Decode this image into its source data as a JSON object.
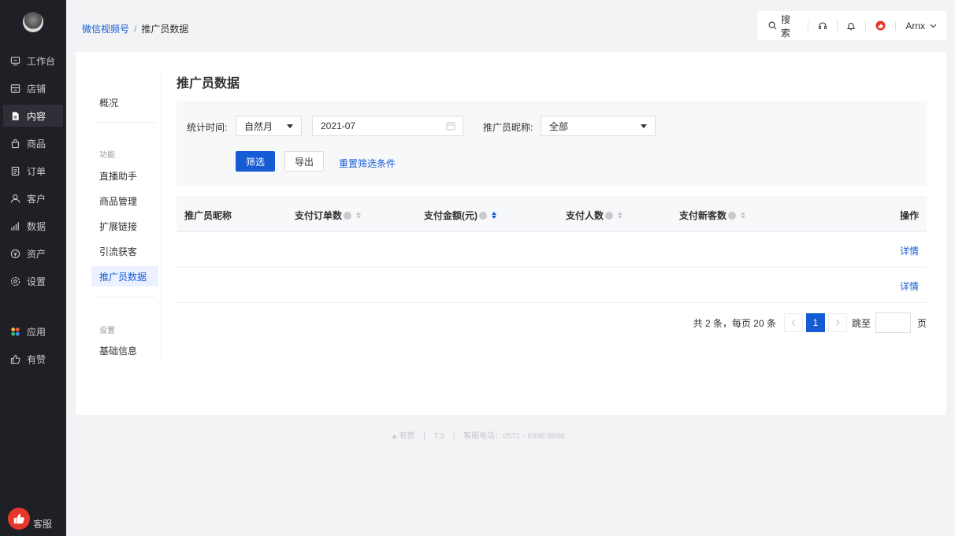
{
  "sidebar": {
    "items": [
      {
        "label": "工作台",
        "icon": "workbench-icon"
      },
      {
        "label": "店铺",
        "icon": "store-icon"
      },
      {
        "label": "内容",
        "icon": "content-icon",
        "active": true
      },
      {
        "label": "商品",
        "icon": "goods-icon"
      },
      {
        "label": "订单",
        "icon": "order-icon"
      },
      {
        "label": "客户",
        "icon": "customer-icon"
      },
      {
        "label": "数据",
        "icon": "data-icon"
      },
      {
        "label": "资产",
        "icon": "asset-icon"
      },
      {
        "label": "设置",
        "icon": "settings-icon"
      },
      {
        "label": "应用",
        "icon": "apps-icon"
      },
      {
        "label": "有赞",
        "icon": "youzan-icon"
      }
    ],
    "helper_label": "客服"
  },
  "breadcrumb": {
    "parent": "微信视频号",
    "separator": "/",
    "current": "推广员数据"
  },
  "topbar": {
    "search_label": "搜索",
    "user_name": "Arnx"
  },
  "submenu": {
    "overview": "概况",
    "group_function": "功能",
    "items": [
      "直播助手",
      "商品管理",
      "扩展链接",
      "引流获客",
      "推广员数据"
    ],
    "group_settings": "设置",
    "basic_info": "基础信息"
  },
  "page": {
    "title": "推广员数据"
  },
  "filter": {
    "time_label": "统计时间:",
    "period_value": "自然月",
    "date_value": "2021-07",
    "nickname_label": "推广员昵称:",
    "nickname_value": "全部",
    "filter_button": "筛选",
    "export_button": "导出",
    "reset_link": "重置筛选条件"
  },
  "table": {
    "columns": [
      "推广员昵称",
      "支付订单数",
      "支付金额(元)",
      "支付人数",
      "支付新客数",
      "操作"
    ],
    "rows": [
      {
        "action": "详情"
      },
      {
        "action": "详情"
      }
    ]
  },
  "pagination": {
    "summary": "共 2 条，每页 20 条",
    "current_page": "1",
    "jump_label": "跳至",
    "page_unit": "页"
  },
  "footer": {
    "brand": "有赞",
    "version": "T.3",
    "hotline": "客服电话：0571 - 8998 8848",
    "separator": "|"
  },
  "colors": {
    "accent": "#155bd4",
    "sidebar_bg": "#1f2026",
    "brand_red": "#e6372b"
  }
}
